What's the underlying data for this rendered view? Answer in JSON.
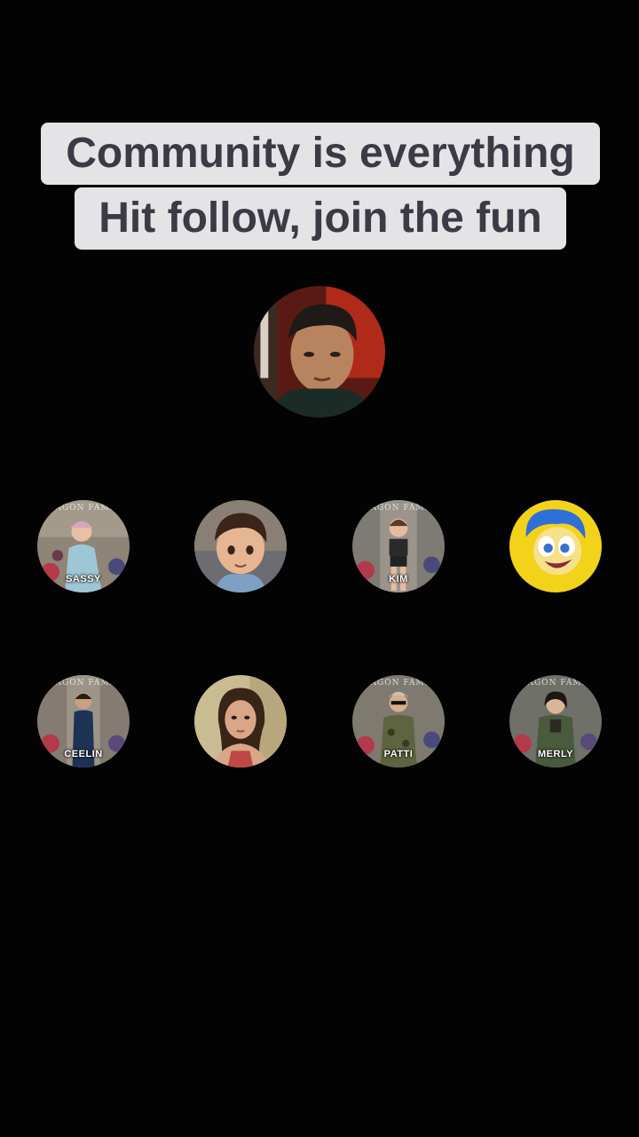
{
  "caption": {
    "line1": "Community is everything",
    "line2": "Hit follow, join the fun"
  },
  "host": {
    "icon": "host-avatar-photo"
  },
  "members": [
    {
      "name": "SASSY",
      "style": "badge",
      "bg": "#8f8478",
      "skin": "#e8c0a2",
      "outfit": "#9ec7d6"
    },
    {
      "name": "",
      "style": "cartoon-boy",
      "bg": "#6b6d70"
    },
    {
      "name": "KIM",
      "style": "badge",
      "bg": "#7e7a74",
      "skin": "#e4bda0",
      "outfit": "#2a2a2a"
    },
    {
      "name": "",
      "style": "cartoon-joy",
      "bg": "#f3d21a"
    },
    {
      "name": "CEELIN",
      "style": "badge",
      "bg": "#847c72",
      "skin": "#caa084",
      "outfit": "#1d3355"
    },
    {
      "name": "",
      "style": "portrait",
      "bg": "#c9bb92"
    },
    {
      "name": "PATTI",
      "style": "badge",
      "bg": "#7f7a70",
      "skin": "#d6b092",
      "outfit": "#5f6440"
    },
    {
      "name": "MERLY",
      "style": "badge",
      "bg": "#6f7068",
      "skin": "#d8b69a",
      "outfit": "#4a5a3c"
    }
  ],
  "badge_arc_text": "DRAGON FAMILY"
}
